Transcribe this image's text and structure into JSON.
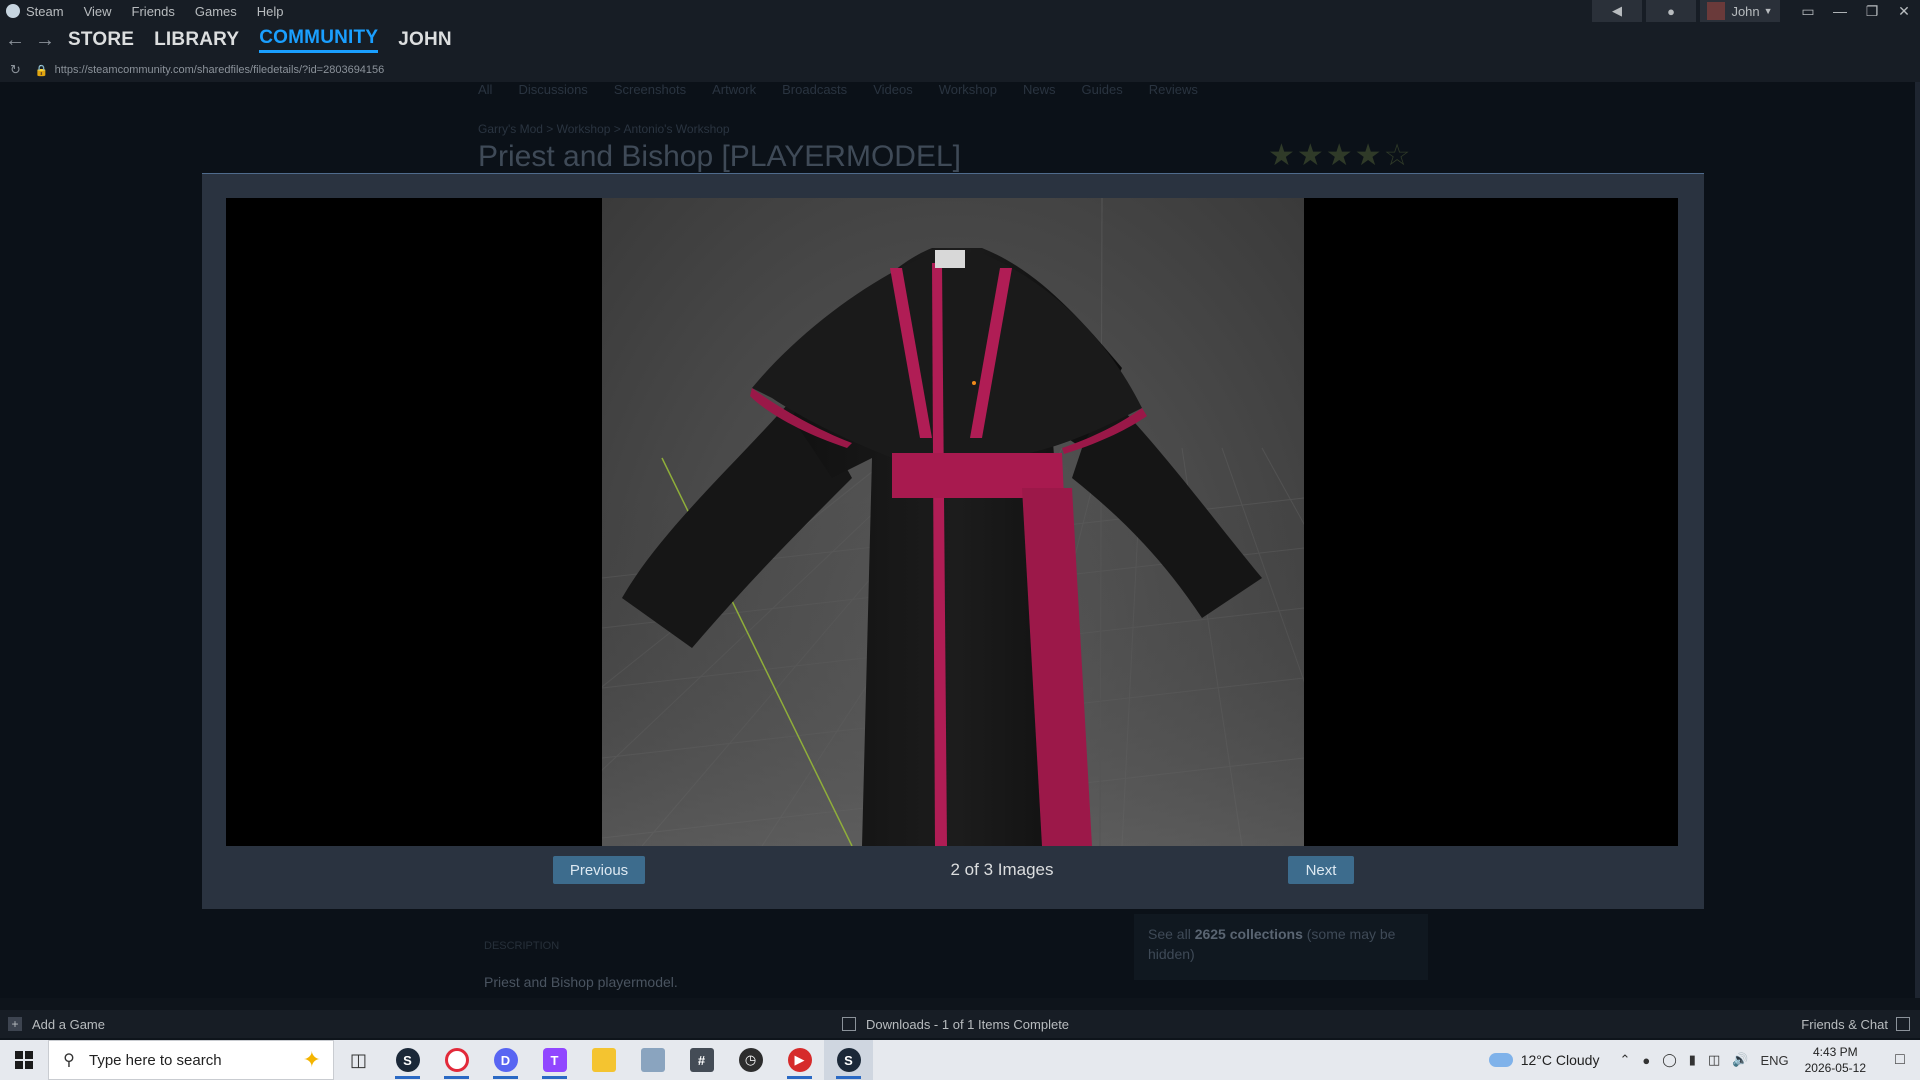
{
  "menubar": {
    "items": [
      "Steam",
      "View",
      "Friends",
      "Games",
      "Help"
    ],
    "user_name": "John"
  },
  "navbar": {
    "tabs": [
      "STORE",
      "LIBRARY",
      "COMMUNITY",
      "JOHN"
    ],
    "active_tab": "COMMUNITY"
  },
  "urlbar": {
    "url": "https://steamcommunity.com/sharedfiles/filedetails/?id=2803694156"
  },
  "background_page": {
    "tabs": [
      "All",
      "Discussions",
      "Screenshots",
      "Artwork",
      "Broadcasts",
      "Videos",
      "Workshop",
      "News",
      "Guides",
      "Reviews"
    ],
    "breadcrumb": "Garry's Mod > Workshop > Antonio's Workshop",
    "title": "Priest and Bishop [PLAYERMODEL]",
    "stars": "★★★★☆",
    "description_header": "DESCRIPTION",
    "description_text": "Priest and Bishop playermodel.",
    "collections_prefix": "See all",
    "collections_count": "2625 collections",
    "collections_suffix": "(some may be hidden)"
  },
  "modal": {
    "prev_label": "Previous",
    "next_label": "Next",
    "counter": "2 of 3 Images"
  },
  "statusbar": {
    "add_game": "Add a Game",
    "downloads": "Downloads - 1 of 1 Items Complete",
    "friends": "Friends & Chat"
  },
  "taskbar": {
    "search_placeholder": "Type here to search",
    "weather": "12°C  Cloudy",
    "language": "ENG",
    "time": "4:43 PM",
    "date": "2026-05-12",
    "colors": {
      "steam": "#1b2838",
      "opera": "#e22a3a",
      "discord": "#5865f2",
      "twitch": "#9146ff",
      "explorer": "#f4c430",
      "calculator": "#444c56",
      "clock": "#2d2d2d",
      "media": "#d62b2b"
    }
  },
  "accent_color": "#1a9fff",
  "button_color": "#3d6c8d"
}
